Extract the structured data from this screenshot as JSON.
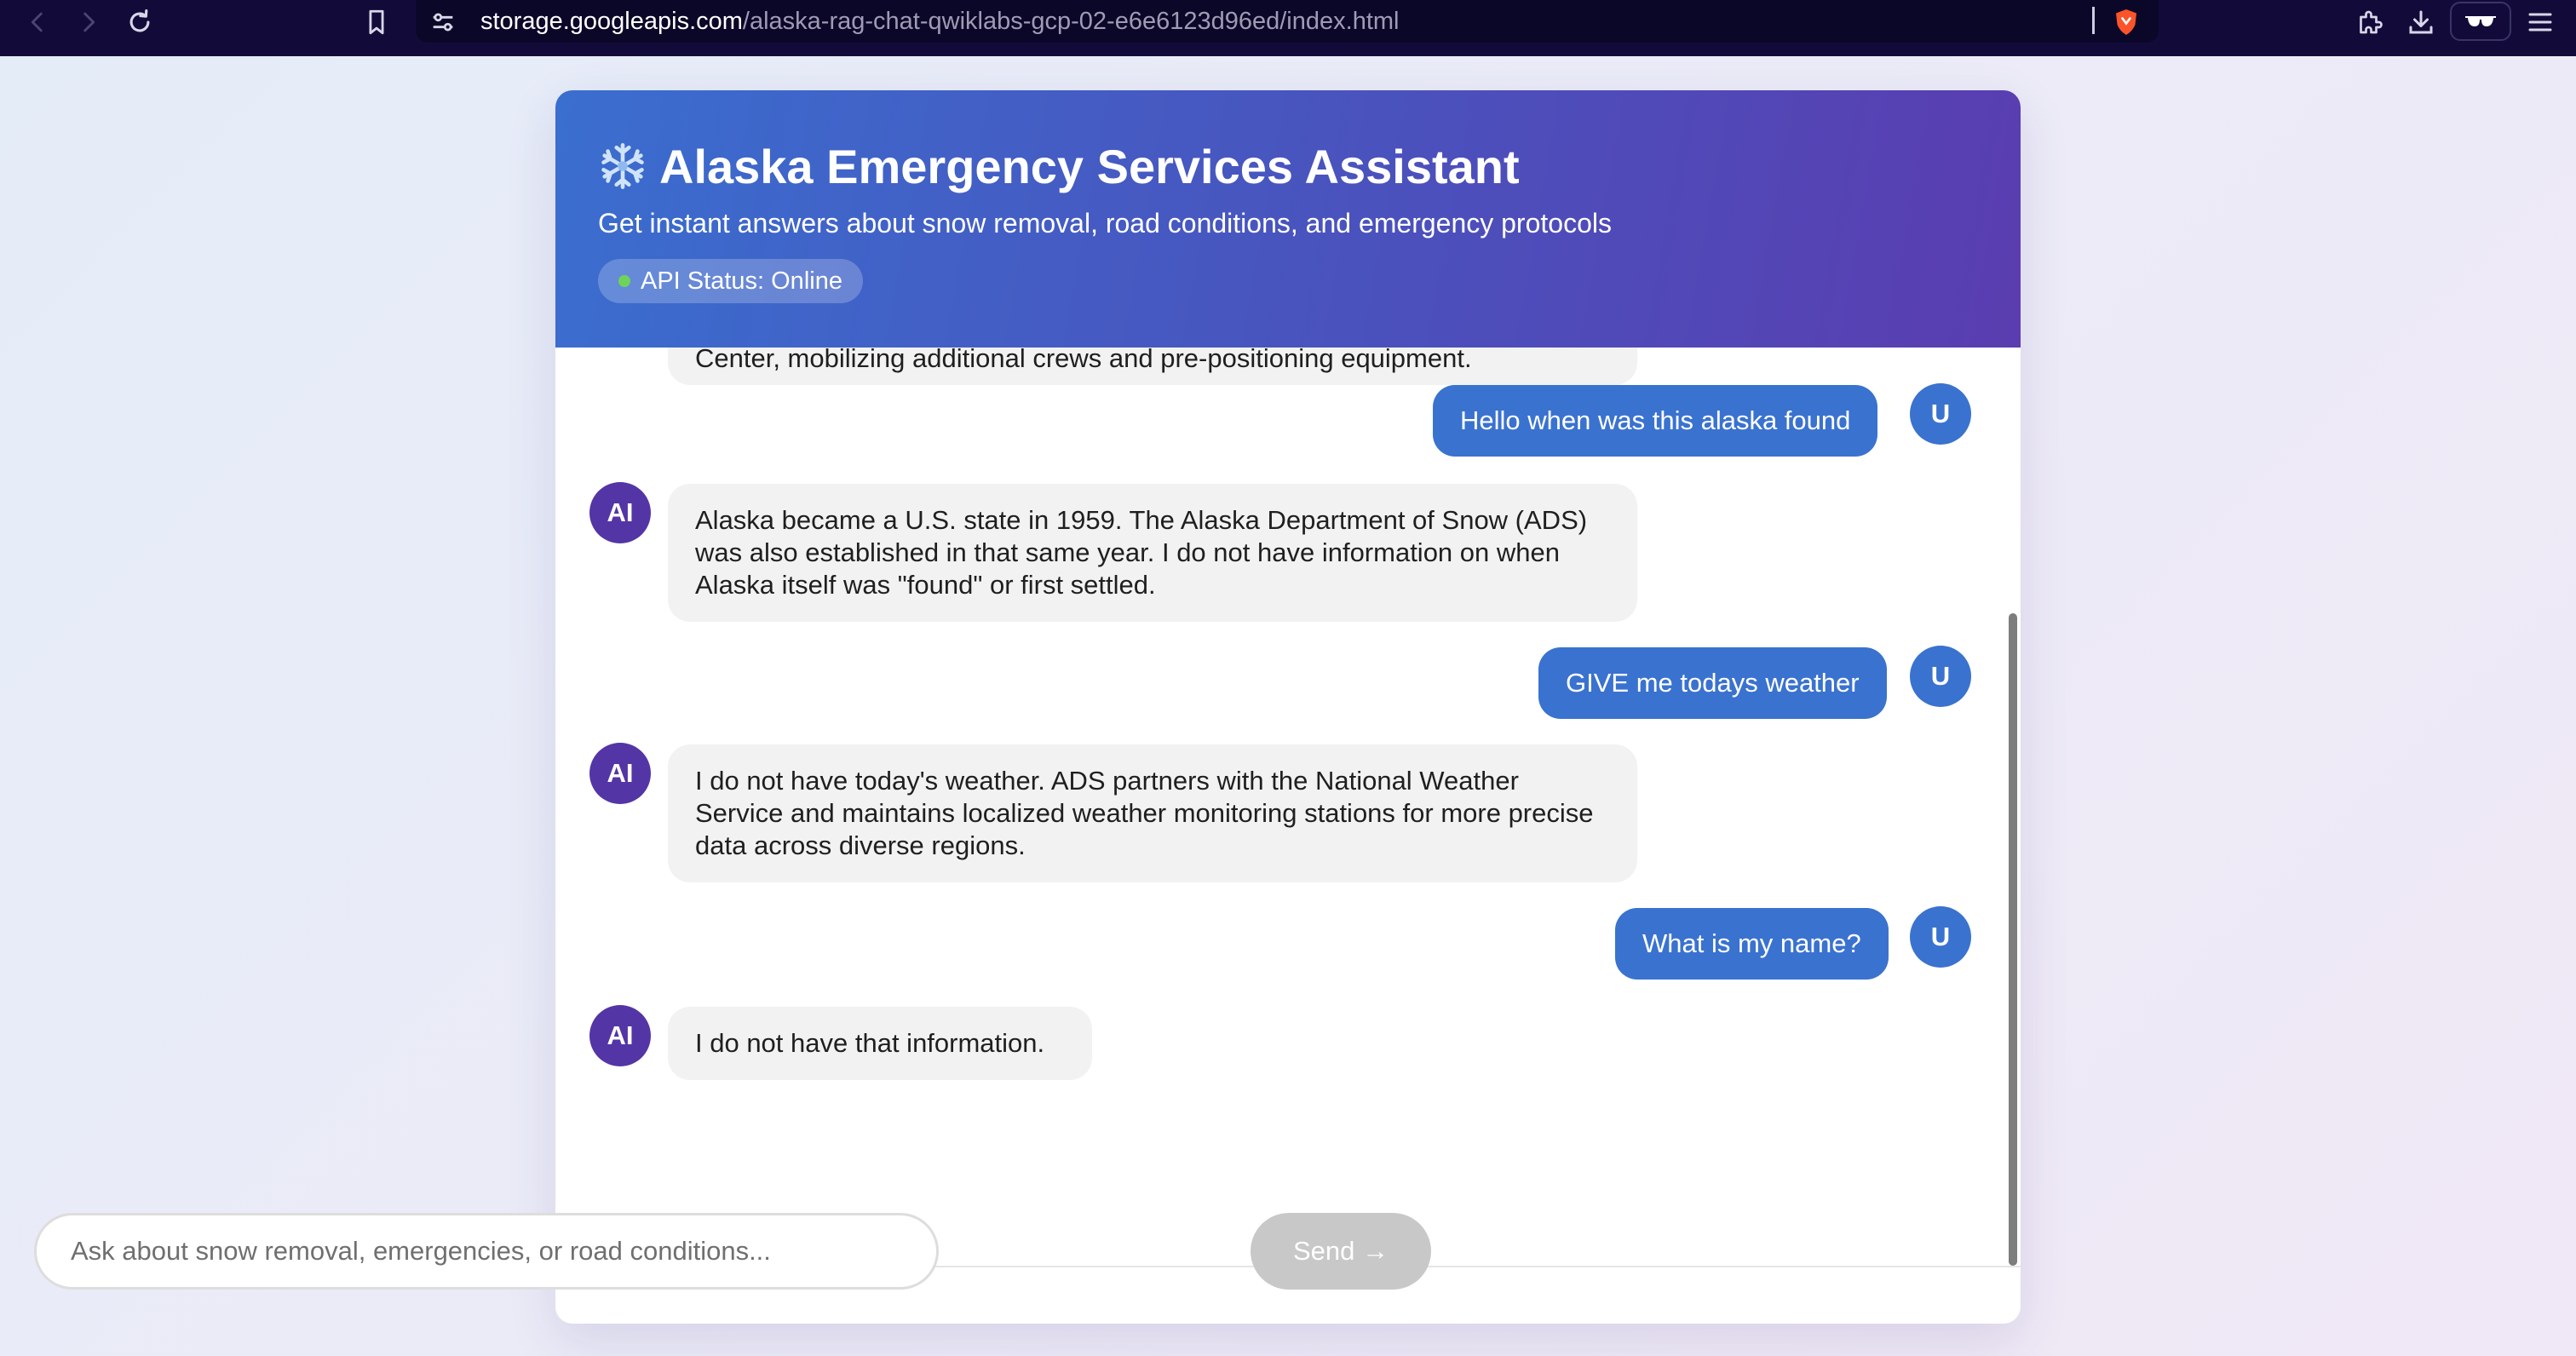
{
  "browser": {
    "url_host": "storage.googleapis.com",
    "url_path": "/alaska-rag-chat-qwiklabs-gcp-02-e6e6123d96ed/index.html"
  },
  "header": {
    "title": "Alaska Emergency Services Assistant",
    "subtitle": "Get instant answers about snow removal, road conditions, and emergency protocols",
    "status": "API Status: Online",
    "status_color": "#6fd35a"
  },
  "messages": [
    {
      "role": "ai",
      "text": "Center, mobilizing additional crews and pre-positioning equipment."
    },
    {
      "role": "user",
      "avatar": "U",
      "text": "Hello when was this alaska found"
    },
    {
      "role": "ai",
      "avatar": "AI",
      "text": "Alaska became a U.S. state in 1959. The Alaska Department of Snow (ADS) was also established in that same year. I do not have information on when Alaska itself was \"found\" or first settled."
    },
    {
      "role": "user",
      "avatar": "U",
      "text": "GIVE me todays weather"
    },
    {
      "role": "ai",
      "avatar": "AI",
      "text": "I do not have today's weather. ADS partners with the National Weather Service and maintains localized weather monitoring stations for more precise data across diverse regions."
    },
    {
      "role": "user",
      "avatar": "U",
      "text": "What is my name?"
    },
    {
      "role": "ai",
      "avatar": "AI",
      "text": "I do not have that information."
    }
  ],
  "input": {
    "placeholder": "Ask about snow removal, emergencies, or road conditions...",
    "value": ""
  },
  "send_label": "Send →",
  "colors": {
    "header_start": "#3a6ecf",
    "header_end": "#5a3db0",
    "user_bubble": "#3a72cf",
    "ai_avatar": "#5335a6",
    "ai_bubble": "#f2f2f3",
    "send_disabled": "#c8c8c8"
  },
  "icons": {
    "title": "snowflake-icon",
    "browser": [
      "back-icon",
      "forward-icon",
      "reload-icon",
      "bookmark-icon",
      "site-settings-icon",
      "brave-shield-icon",
      "extensions-icon",
      "download-icon",
      "reader-mode-icon",
      "menu-icon"
    ]
  }
}
